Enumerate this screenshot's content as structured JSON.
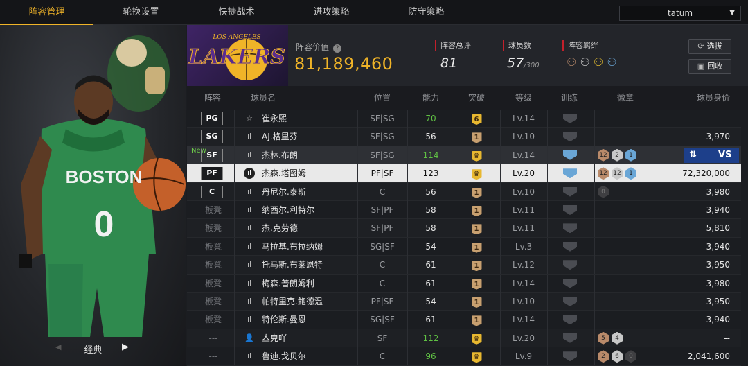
{
  "tabs": [
    "阵容管理",
    "轮换设置",
    "快捷战术",
    "进攻策略",
    "防守策略"
  ],
  "active_tab": 0,
  "player_selector": {
    "value": "tatum"
  },
  "left_panel": {
    "card_label": "经典",
    "jersey_team": "BOSTON",
    "jersey_number": "0"
  },
  "header": {
    "team_logo_text": "LAKERS",
    "team_logo_sub": "LOS ANGELES",
    "value_label": "阵容价值",
    "value": "81,189,460",
    "overall_label": "阵容总评",
    "overall": "81",
    "count_label": "球员数",
    "count": "57",
    "count_max": "/300",
    "bonds_label": "阵容羁绊",
    "select_btn": "选拔",
    "recycle_btn": "回收"
  },
  "columns": [
    "阵容",
    "球员名",
    "位置",
    "能力",
    "突破",
    "等级",
    "训练",
    "徽章",
    "球员身价"
  ],
  "rows": [
    {
      "slot": "PG",
      "name": "崔永熙",
      "pos": "SF|SG",
      "rating": "70",
      "rating_green": true,
      "brk": "6",
      "brk_gold": true,
      "level": "Lv.14",
      "train": "dim",
      "badges": [],
      "value": "--",
      "icon": "☆",
      "style": "normal"
    },
    {
      "slot": "SG",
      "name": "AJ.格里芬",
      "pos": "SF|SG",
      "rating": "56",
      "rating_green": false,
      "brk": "1",
      "brk_gold": false,
      "level": "Lv.10",
      "train": "dim",
      "badges": [],
      "value": "3,970",
      "icon": "ıl",
      "style": "alt"
    },
    {
      "slot": "SF",
      "name": "杰林.布朗",
      "pos": "SF|SG",
      "rating": "114",
      "rating_green": true,
      "brk": "♛",
      "brk_gold": true,
      "level": "Lv.14",
      "train": "blue",
      "badges": [
        {
          "t": "12",
          "c": "bronze"
        },
        {
          "t": "2",
          "c": "silver"
        },
        {
          "t": "1",
          "c": "blue"
        }
      ],
      "value": "",
      "icon": "ıl",
      "style": "new",
      "new_tag": "New",
      "swap": true
    },
    {
      "slot": "PF",
      "name": "杰森.塔图姆",
      "pos": "PF|SF",
      "rating": "123",
      "rating_green": false,
      "brk": "♛",
      "brk_gold": true,
      "level": "Lv.20",
      "train": "blue",
      "badges": [
        {
          "t": "12",
          "c": "bronze"
        },
        {
          "t": "12",
          "c": "silver"
        },
        {
          "t": "1",
          "c": "blue"
        }
      ],
      "value": "72,320,000",
      "icon": "ıl",
      "style": "sel"
    },
    {
      "slot": "C",
      "name": "丹尼尔.泰斯",
      "pos": "C",
      "rating": "56",
      "rating_green": false,
      "brk": "1",
      "brk_gold": false,
      "level": "Lv.10",
      "train": "dim",
      "badges": [
        {
          "t": "0",
          "c": "dim"
        }
      ],
      "value": "3,980",
      "icon": "ıl",
      "style": "alt"
    },
    {
      "slot": "板凳",
      "name": "纳西尔.利特尔",
      "pos": "SF|PF",
      "rating": "58",
      "rating_green": false,
      "brk": "1",
      "brk_gold": false,
      "level": "Lv.11",
      "train": "dim",
      "badges": [],
      "value": "3,940",
      "icon": "ıl",
      "style": "normal"
    },
    {
      "slot": "板凳",
      "name": "杰.克劳德",
      "pos": "SF|PF",
      "rating": "58",
      "rating_green": false,
      "brk": "1",
      "brk_gold": false,
      "level": "Lv.11",
      "train": "dim",
      "badges": [],
      "value": "5,810",
      "icon": "ıl",
      "style": "alt"
    },
    {
      "slot": "板凳",
      "name": "马拉基.布拉纳姆",
      "pos": "SG|SF",
      "rating": "54",
      "rating_green": false,
      "brk": "1",
      "brk_gold": false,
      "level": "Lv.3",
      "train": "dim",
      "badges": [],
      "value": "3,940",
      "icon": "ıl",
      "style": "normal"
    },
    {
      "slot": "板凳",
      "name": "托马斯.布莱恩特",
      "pos": "C",
      "rating": "61",
      "rating_green": false,
      "brk": "1",
      "brk_gold": false,
      "level": "Lv.12",
      "train": "dim",
      "badges": [],
      "value": "3,950",
      "icon": "ıl",
      "style": "alt"
    },
    {
      "slot": "板凳",
      "name": "梅森.普朗姆利",
      "pos": "C",
      "rating": "61",
      "rating_green": false,
      "brk": "1",
      "brk_gold": false,
      "level": "Lv.14",
      "train": "dim",
      "badges": [],
      "value": "3,980",
      "icon": "ıl",
      "style": "normal"
    },
    {
      "slot": "板凳",
      "name": "帕特里克.鲍德温",
      "pos": "PF|SF",
      "rating": "54",
      "rating_green": false,
      "brk": "1",
      "brk_gold": false,
      "level": "Lv.10",
      "train": "dim",
      "badges": [],
      "value": "3,950",
      "icon": "ıl",
      "style": "alt"
    },
    {
      "slot": "板凳",
      "name": "特伦斯.曼恩",
      "pos": "SG|SF",
      "rating": "61",
      "rating_green": false,
      "brk": "1",
      "brk_gold": false,
      "level": "Lv.14",
      "train": "dim",
      "badges": [],
      "value": "3,940",
      "icon": "ıl",
      "style": "normal"
    },
    {
      "slot": "---",
      "name": "亼皃吖",
      "pos": "SF",
      "rating": "112",
      "rating_green": true,
      "brk": "♛",
      "brk_gold": true,
      "level": "Lv.20",
      "train": "dim",
      "badges": [
        {
          "t": "5",
          "c": "bronze"
        },
        {
          "t": "4",
          "c": "silver"
        }
      ],
      "value": "--",
      "icon": "👤",
      "style": "alt"
    },
    {
      "slot": "---",
      "name": "鲁迪.戈贝尔",
      "pos": "C",
      "rating": "96",
      "rating_green": true,
      "brk": "♛",
      "brk_gold": true,
      "level": "Lv.9",
      "train": "dim",
      "badges": [
        {
          "t": "2",
          "c": "bronze"
        },
        {
          "t": "6",
          "c": "silver"
        },
        {
          "t": "0",
          "c": "dim"
        }
      ],
      "value": "2,041,600",
      "icon": "ıl",
      "style": "normal"
    }
  ],
  "swap_icon": "⇅",
  "vs_label": "VS"
}
